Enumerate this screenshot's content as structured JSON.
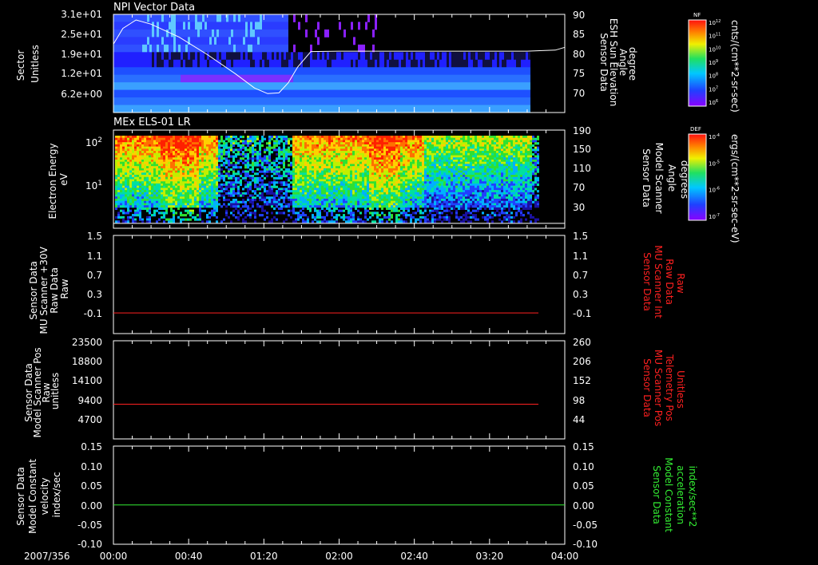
{
  "chart_data": [
    {
      "type": "heatmap",
      "title": "NPI Vector Data",
      "left_label": [
        "Sector",
        "Unitless"
      ],
      "left_ticks": [
        "3.1e+01",
        "2.5e+01",
        "1.9e+01",
        "1.2e+01",
        "6.2e+00"
      ],
      "right_label": [
        "Sensor Data",
        "ESH Sun Elevation",
        "Angle",
        "degree"
      ],
      "right_ticks": [
        "90",
        "85",
        "80",
        "75",
        "70"
      ],
      "right_label_color": "#ffffff",
      "colorbar": {
        "title": "NF",
        "unit": "cnts/(cm**2-sr-sec)",
        "ticks": [
          "10^12",
          "10^11",
          "10^10",
          "10^9",
          "10^8",
          "10^7",
          "10^6"
        ]
      },
      "overlay_line": {
        "color": "#ffffff",
        "x_minutes": [
          0,
          5,
          12,
          20,
          35,
          50,
          65,
          75,
          82,
          88,
          93,
          98,
          105,
          120,
          160,
          200,
          220,
          235,
          240
        ],
        "y_degrees": [
          81.5,
          86.0,
          88.4,
          87.2,
          83.5,
          78.5,
          73.0,
          69.0,
          67.4,
          67.6,
          70.5,
          75.0,
          79.4,
          79.5,
          79.5,
          79.5,
          79.5,
          79.8,
          80.6
        ]
      }
    },
    {
      "type": "heatmap",
      "title": "MEx ELS-01 LR",
      "left_label": [
        "Electron Energy",
        "eV"
      ],
      "left_ticks": [
        "10^2",
        "10^1"
      ],
      "right_label": [
        "Sensor Data",
        "Model Scanner",
        "Angle",
        "degrees"
      ],
      "right_ticks": [
        "190",
        "150",
        "110",
        "70",
        "30"
      ],
      "right_label_color": "#ffffff",
      "colorbar": {
        "title": "DEF",
        "unit": "ergs/(cm**2-sr-sec-eV)",
        "ticks": [
          "10^-4",
          "10^-5",
          "10^-6",
          "10^-7"
        ]
      },
      "overlay_line": {
        "color": "#ffffff",
        "x_minutes": [
          0,
          240
        ],
        "y_degrees": [
          10,
          10
        ]
      }
    },
    {
      "type": "line",
      "left_label": [
        "Sensor Data",
        "MU Scanner +30V",
        "Raw Data",
        "Raw"
      ],
      "left_ticks": [
        "1.5",
        "1.1",
        "0.7",
        "0.3",
        "-0.1"
      ],
      "ylim": [
        -0.4,
        1.5
      ],
      "right_label": [
        "Sensor Data",
        "MU Scanner Int",
        "Raw Data",
        "Raw"
      ],
      "right_ticks": [
        "1.5",
        "1.1",
        "0.7",
        "0.3",
        "-0.1"
      ],
      "right_label_color": "#ff2020",
      "series": [
        {
          "color": "#ff2020",
          "x_minutes": [
            0,
            226
          ],
          "values": [
            0.0,
            0.0
          ]
        }
      ]
    },
    {
      "type": "line",
      "left_label": [
        "Sensor Data",
        "Model Scanner Pos",
        "Raw",
        "unitless"
      ],
      "left_ticks": [
        "23500",
        "18800",
        "14100",
        "9400",
        "4700"
      ],
      "ylim": [
        0,
        23500
      ],
      "right_label": [
        "Sensor Data",
        "MU Scanner Pos",
        "Telemetry Pos",
        "Unitless"
      ],
      "right_ticks": [
        "260",
        "206",
        "152",
        "98",
        "44"
      ],
      "right_label_color": "#ff2020",
      "series": [
        {
          "color": "#ff2020",
          "x_minutes": [
            0,
            226
          ],
          "values": [
            8300,
            8300
          ]
        }
      ]
    },
    {
      "type": "line",
      "left_label": [
        "Sensor Data",
        "Model Constant",
        "velocity",
        "index/sec"
      ],
      "left_ticks": [
        "0.15",
        "0.10",
        "0.05",
        "0.00",
        "-0.05",
        "-0.10"
      ],
      "ylim": [
        -0.1,
        0.15
      ],
      "right_label": [
        "Sensor Data",
        "Model Constant",
        "acceleration",
        "index/sec**2"
      ],
      "right_ticks": [
        "0.15",
        "0.10",
        "0.05",
        "0.00",
        "-0.05",
        "-0.10"
      ],
      "right_label_color": "#33ee33",
      "series": [
        {
          "color": "#33ee33",
          "x_minutes": [
            0,
            240
          ],
          "values": [
            0.0,
            0.0
          ]
        }
      ]
    }
  ],
  "x_axis": {
    "date": "2007/356",
    "tick_labels": [
      "00:00",
      "00:40",
      "01:20",
      "02:00",
      "02:40",
      "03:20",
      "04:00"
    ],
    "range_minutes": [
      0,
      240
    ]
  }
}
